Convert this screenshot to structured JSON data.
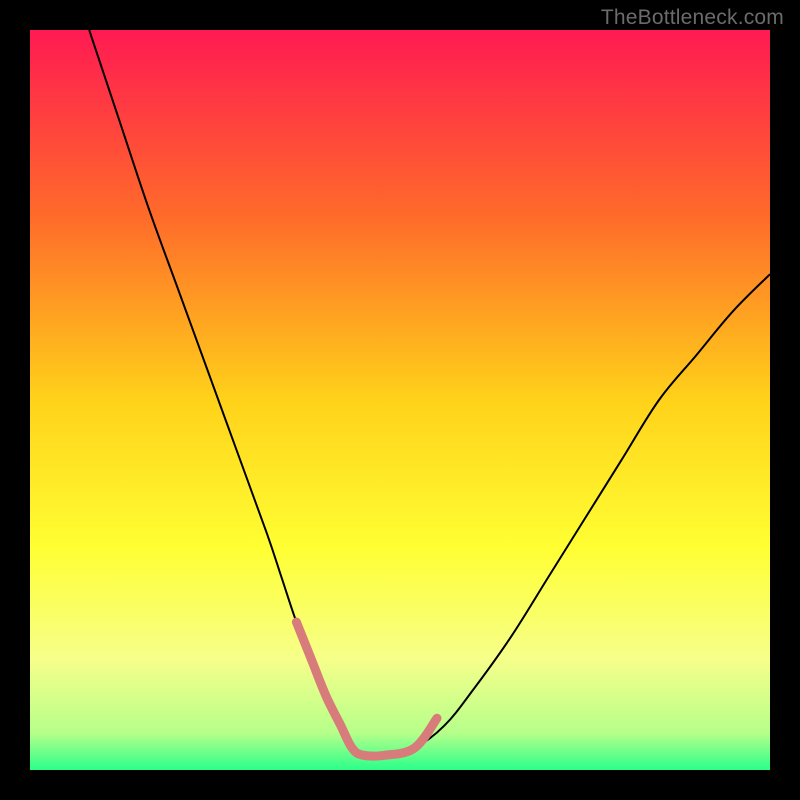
{
  "watermark": "TheBottleneck.com",
  "chart_data": {
    "type": "line",
    "title": "",
    "xlabel": "",
    "ylabel": "",
    "xlim": [
      0,
      100
    ],
    "ylim": [
      0,
      100
    ],
    "grid": false,
    "legend": false,
    "gradient_stops": [
      {
        "offset": 0.0,
        "color": "#ff1a52"
      },
      {
        "offset": 0.25,
        "color": "#ff6a2a"
      },
      {
        "offset": 0.5,
        "color": "#ffd21a"
      },
      {
        "offset": 0.7,
        "color": "#ffff33"
      },
      {
        "offset": 0.85,
        "color": "#f6ff8a"
      },
      {
        "offset": 0.95,
        "color": "#b6ff8a"
      },
      {
        "offset": 1.0,
        "color": "#2aff8a"
      }
    ],
    "series": [
      {
        "name": "bottleneck-curve",
        "stroke": "#000000",
        "stroke_width": 2,
        "x": [
          8,
          12,
          16,
          20,
          24,
          28,
          32,
          34,
          36,
          38,
          40,
          42,
          43.5,
          45,
          48,
          52,
          56,
          60,
          65,
          70,
          75,
          80,
          85,
          90,
          95,
          100
        ],
        "values": [
          100,
          88,
          76,
          65,
          54,
          43,
          32,
          26,
          20,
          15,
          10,
          6,
          3,
          2,
          2,
          3,
          6,
          11,
          18,
          26,
          34,
          42,
          50,
          56,
          62,
          67
        ]
      },
      {
        "name": "sweet-spot-highlight",
        "stroke": "#d87b7b",
        "stroke_width": 9,
        "linecap": "round",
        "x": [
          36,
          38,
          40,
          42,
          43.5,
          45,
          48,
          52,
          55
        ],
        "values": [
          20,
          15,
          10,
          6,
          3,
          2,
          2,
          3,
          7
        ]
      }
    ]
  }
}
